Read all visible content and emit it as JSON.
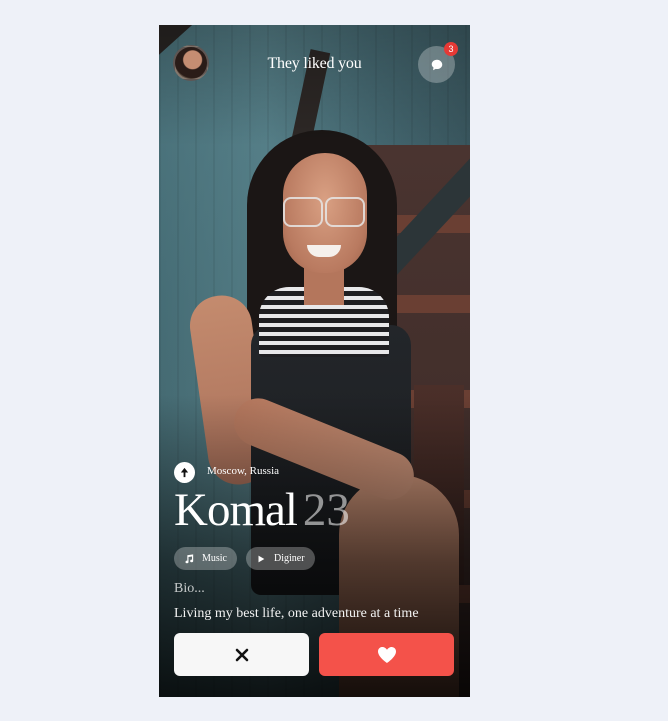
{
  "header": {
    "title": "They liked you",
    "avatar_icon": "avatar",
    "messages_icon": "chat-bubble-icon",
    "messages_badge": "3"
  },
  "profile": {
    "location": "Moscow, Russia",
    "location_icon": "navigation-arrow-icon",
    "name": "Komal",
    "age": "23",
    "interests": [
      {
        "label": "Music",
        "icon": "music-note-icon"
      },
      {
        "label": "Diginer",
        "icon": "play-icon"
      }
    ],
    "bio_label": "Bio...",
    "bio_text": "Living my best life, one adventure at a time"
  },
  "actions": {
    "pass_icon": "close-icon",
    "like_icon": "heart-icon",
    "like_color": "#f4524a",
    "pass_color": "#f7f7f7"
  },
  "colors": {
    "page_background": "#eef1f8",
    "badge": "#e53935"
  }
}
